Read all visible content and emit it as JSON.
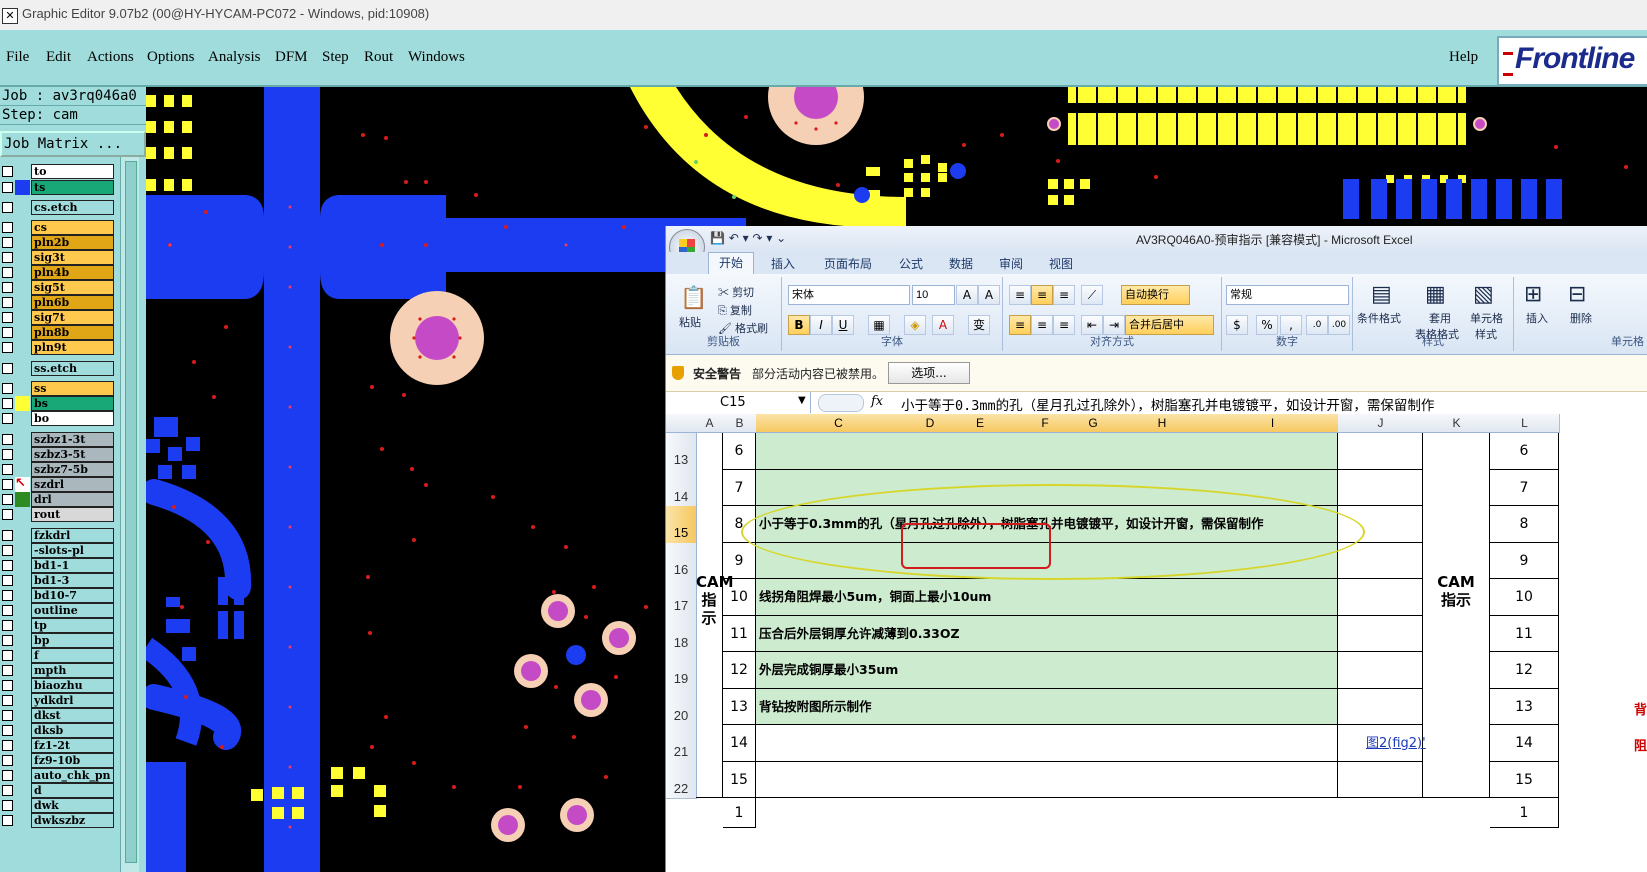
{
  "window": {
    "title": "Graphic Editor 9.07b2 (00@HY-HYCAM-PC072 - Windows, pid:10908)"
  },
  "menu": {
    "items": [
      "File",
      "Edit",
      "Actions",
      "Options",
      "Analysis",
      "DFM",
      "Step",
      "Rout",
      "Windows"
    ],
    "help": "Help",
    "logo": "Frontline"
  },
  "job": {
    "job_line": "Job : av3rq046a0",
    "step_line": "Step: cam",
    "matrix_button": "Job Matrix ..."
  },
  "layers": [
    {
      "name": "to",
      "bg": "#ffffff",
      "swatch": ""
    },
    {
      "name": "ts",
      "bg": "#18a878",
      "swatch": "#1b3cf0"
    },
    {
      "name": "cs.etch",
      "bg": "#9fdcdb",
      "swatch": ""
    },
    {
      "name": "cs",
      "bg": "#ffc94d",
      "swatch": ""
    },
    {
      "name": "pln2b",
      "bg": "#e0a615",
      "swatch": ""
    },
    {
      "name": "sig3t",
      "bg": "#ffc94d",
      "swatch": ""
    },
    {
      "name": "pln4b",
      "bg": "#e0a615",
      "swatch": ""
    },
    {
      "name": "sig5t",
      "bg": "#ffc94d",
      "swatch": ""
    },
    {
      "name": "pln6b",
      "bg": "#e0a615",
      "swatch": ""
    },
    {
      "name": "sig7t",
      "bg": "#ffc94d",
      "swatch": ""
    },
    {
      "name": "pln8b",
      "bg": "#e0a615",
      "swatch": ""
    },
    {
      "name": "pln9t",
      "bg": "#ffc94d",
      "swatch": ""
    },
    {
      "name": "ss.etch",
      "bg": "#9fdcdb",
      "swatch": ""
    },
    {
      "name": "ss",
      "bg": "#ffc94d",
      "swatch": ""
    },
    {
      "name": "bs",
      "bg": "#18a878",
      "swatch": "#ffff33"
    },
    {
      "name": "bo",
      "bg": "#ffffff",
      "swatch": ""
    },
    {
      "name": "szbz1-3t",
      "bg": "#aab8be",
      "swatch": ""
    },
    {
      "name": "szbz3-5t",
      "bg": "#aab8be",
      "swatch": ""
    },
    {
      "name": "szbz7-5b",
      "bg": "#aab8be",
      "swatch": ""
    },
    {
      "name": "szdrl",
      "bg": "#aab8be",
      "swatch": "#ffffff"
    },
    {
      "name": "drl",
      "bg": "#aab8be",
      "swatch": "#2e8b22"
    },
    {
      "name": "rout",
      "bg": "#d8d8d8",
      "swatch": ""
    },
    {
      "name": "fzkdrl",
      "bg": "#9fdcdb",
      "swatch": ""
    },
    {
      "name": "-slots-pl",
      "bg": "#9fdcdb",
      "swatch": ""
    },
    {
      "name": "bd1-1",
      "bg": "#9fdcdb",
      "swatch": ""
    },
    {
      "name": "bd1-3",
      "bg": "#9fdcdb",
      "swatch": ""
    },
    {
      "name": "bd10-7",
      "bg": "#9fdcdb",
      "swatch": ""
    },
    {
      "name": "outline",
      "bg": "#9fdcdb",
      "swatch": ""
    },
    {
      "name": "tp",
      "bg": "#9fdcdb",
      "swatch": ""
    },
    {
      "name": "bp",
      "bg": "#9fdcdb",
      "swatch": ""
    },
    {
      "name": "f",
      "bg": "#9fdcdb",
      "swatch": ""
    },
    {
      "name": "mpth",
      "bg": "#9fdcdb",
      "swatch": ""
    },
    {
      "name": "biaozhu",
      "bg": "#9fdcdb",
      "swatch": ""
    },
    {
      "name": "ydkdrl",
      "bg": "#9fdcdb",
      "swatch": ""
    },
    {
      "name": "dkst",
      "bg": "#9fdcdb",
      "swatch": ""
    },
    {
      "name": "dksb",
      "bg": "#9fdcdb",
      "swatch": ""
    },
    {
      "name": "fz1-2t",
      "bg": "#9fdcdb",
      "swatch": ""
    },
    {
      "name": "fz9-10b",
      "bg": "#9fdcdb",
      "swatch": ""
    },
    {
      "name": "auto_chk_pn",
      "bg": "#9fdcdb",
      "swatch": ""
    },
    {
      "name": "d",
      "bg": "#9fdcdb",
      "swatch": ""
    },
    {
      "name": "dwk",
      "bg": "#9fdcdb",
      "swatch": ""
    },
    {
      "name": "dwkszbz",
      "bg": "#9fdcdb",
      "swatch": ""
    }
  ],
  "excel": {
    "title": "AV3RQ046A0-预审指示  [兼容模式] - Microsoft Excel",
    "tabs": [
      "开始",
      "插入",
      "页面布局",
      "公式",
      "数据",
      "审阅",
      "视图"
    ],
    "ribbon": {
      "clipboard": {
        "paste": "粘贴",
        "cut": "剪切",
        "copy": "复制",
        "format_painter": "格式刷",
        "label": "剪贴板"
      },
      "font": {
        "name": "宋体",
        "size": "10",
        "label": "字体"
      },
      "alignment": {
        "wrap": "自动换行",
        "merge": "合并后居中",
        "label": "对齐方式"
      },
      "number": {
        "format": "常规",
        "label": "数字"
      },
      "styles": {
        "conditional": "条件格式",
        "table_l1": "套用",
        "table_l2": "表格格式",
        "cell_l1": "单元格",
        "cell_l2": "样式",
        "label": "样式"
      },
      "cells": {
        "insert": "插入",
        "delete": "删除",
        "label": "单元格"
      }
    },
    "security": {
      "title": "安全警告",
      "message": "部分活动内容已被禁用。",
      "options": "选项..."
    },
    "formula_bar": {
      "name_box": "C15",
      "fx": "fx",
      "value": "小于等于0.3mm的孔（星月孔过孔除外），树脂塞孔并电镀镀平，如设计开窗，需保留制作"
    },
    "columns": [
      "A",
      "B",
      "C",
      "D",
      "E",
      "F",
      "G",
      "H",
      "I",
      "J",
      "K",
      "L"
    ],
    "rows": [
      {
        "row": "13",
        "num": "6",
        "text": "",
        "l": "6"
      },
      {
        "row": "14",
        "num": "7",
        "text": "",
        "l": "7"
      },
      {
        "row": "15",
        "num": "8",
        "text": "小于等于0.3mm的孔（星月孔过孔除外），树脂塞孔并电镀镀平，如设计开窗，需保留制作",
        "l": "8"
      },
      {
        "row": "16",
        "num": "9",
        "text": "",
        "l": "9"
      },
      {
        "row": "17",
        "num": "10",
        "text": "线拐角阻焊最小5um，铜面上最小10um",
        "l": "10"
      },
      {
        "row": "18",
        "num": "11",
        "text": "压合后外层铜厚允许减薄到0.33OZ",
        "l": "11"
      },
      {
        "row": "19",
        "num": "12",
        "text": "外层完成铜厚最小35um",
        "l": "12"
      },
      {
        "row": "20",
        "num": "13",
        "text": "背钻按附图所示制作",
        "l": "13"
      },
      {
        "row": "21",
        "num": "14",
        "text": "",
        "l": "14"
      },
      {
        "row": "22",
        "num": "15",
        "text": "",
        "l": "15"
      }
    ],
    "cam_label_line1": "CAM",
    "cam_label_line2": "指示",
    "link_j20": "图2(fig2)'",
    "right_marks": [
      "背",
      "阻"
    ],
    "last_row_num": "1",
    "last_l": "1"
  }
}
